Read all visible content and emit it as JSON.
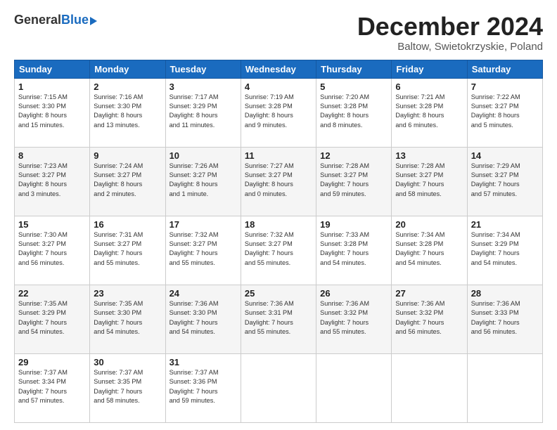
{
  "logo": {
    "general": "General",
    "blue": "Blue"
  },
  "header": {
    "month": "December 2024",
    "location": "Baltow, Swietokrzyskie, Poland"
  },
  "days_of_week": [
    "Sunday",
    "Monday",
    "Tuesday",
    "Wednesday",
    "Thursday",
    "Friday",
    "Saturday"
  ],
  "weeks": [
    [
      {
        "day": "1",
        "info": "Sunrise: 7:15 AM\nSunset: 3:30 PM\nDaylight: 8 hours\nand 15 minutes."
      },
      {
        "day": "2",
        "info": "Sunrise: 7:16 AM\nSunset: 3:30 PM\nDaylight: 8 hours\nand 13 minutes."
      },
      {
        "day": "3",
        "info": "Sunrise: 7:17 AM\nSunset: 3:29 PM\nDaylight: 8 hours\nand 11 minutes."
      },
      {
        "day": "4",
        "info": "Sunrise: 7:19 AM\nSunset: 3:28 PM\nDaylight: 8 hours\nand 9 minutes."
      },
      {
        "day": "5",
        "info": "Sunrise: 7:20 AM\nSunset: 3:28 PM\nDaylight: 8 hours\nand 8 minutes."
      },
      {
        "day": "6",
        "info": "Sunrise: 7:21 AM\nSunset: 3:28 PM\nDaylight: 8 hours\nand 6 minutes."
      },
      {
        "day": "7",
        "info": "Sunrise: 7:22 AM\nSunset: 3:27 PM\nDaylight: 8 hours\nand 5 minutes."
      }
    ],
    [
      {
        "day": "8",
        "info": "Sunrise: 7:23 AM\nSunset: 3:27 PM\nDaylight: 8 hours\nand 3 minutes."
      },
      {
        "day": "9",
        "info": "Sunrise: 7:24 AM\nSunset: 3:27 PM\nDaylight: 8 hours\nand 2 minutes."
      },
      {
        "day": "10",
        "info": "Sunrise: 7:26 AM\nSunset: 3:27 PM\nDaylight: 8 hours\nand 1 minute."
      },
      {
        "day": "11",
        "info": "Sunrise: 7:27 AM\nSunset: 3:27 PM\nDaylight: 8 hours\nand 0 minutes."
      },
      {
        "day": "12",
        "info": "Sunrise: 7:28 AM\nSunset: 3:27 PM\nDaylight: 7 hours\nand 59 minutes."
      },
      {
        "day": "13",
        "info": "Sunrise: 7:28 AM\nSunset: 3:27 PM\nDaylight: 7 hours\nand 58 minutes."
      },
      {
        "day": "14",
        "info": "Sunrise: 7:29 AM\nSunset: 3:27 PM\nDaylight: 7 hours\nand 57 minutes."
      }
    ],
    [
      {
        "day": "15",
        "info": "Sunrise: 7:30 AM\nSunset: 3:27 PM\nDaylight: 7 hours\nand 56 minutes."
      },
      {
        "day": "16",
        "info": "Sunrise: 7:31 AM\nSunset: 3:27 PM\nDaylight: 7 hours\nand 55 minutes."
      },
      {
        "day": "17",
        "info": "Sunrise: 7:32 AM\nSunset: 3:27 PM\nDaylight: 7 hours\nand 55 minutes."
      },
      {
        "day": "18",
        "info": "Sunrise: 7:32 AM\nSunset: 3:27 PM\nDaylight: 7 hours\nand 55 minutes."
      },
      {
        "day": "19",
        "info": "Sunrise: 7:33 AM\nSunset: 3:28 PM\nDaylight: 7 hours\nand 54 minutes."
      },
      {
        "day": "20",
        "info": "Sunrise: 7:34 AM\nSunset: 3:28 PM\nDaylight: 7 hours\nand 54 minutes."
      },
      {
        "day": "21",
        "info": "Sunrise: 7:34 AM\nSunset: 3:29 PM\nDaylight: 7 hours\nand 54 minutes."
      }
    ],
    [
      {
        "day": "22",
        "info": "Sunrise: 7:35 AM\nSunset: 3:29 PM\nDaylight: 7 hours\nand 54 minutes."
      },
      {
        "day": "23",
        "info": "Sunrise: 7:35 AM\nSunset: 3:30 PM\nDaylight: 7 hours\nand 54 minutes."
      },
      {
        "day": "24",
        "info": "Sunrise: 7:36 AM\nSunset: 3:30 PM\nDaylight: 7 hours\nand 54 minutes."
      },
      {
        "day": "25",
        "info": "Sunrise: 7:36 AM\nSunset: 3:31 PM\nDaylight: 7 hours\nand 55 minutes."
      },
      {
        "day": "26",
        "info": "Sunrise: 7:36 AM\nSunset: 3:32 PM\nDaylight: 7 hours\nand 55 minutes."
      },
      {
        "day": "27",
        "info": "Sunrise: 7:36 AM\nSunset: 3:32 PM\nDaylight: 7 hours\nand 56 minutes."
      },
      {
        "day": "28",
        "info": "Sunrise: 7:36 AM\nSunset: 3:33 PM\nDaylight: 7 hours\nand 56 minutes."
      }
    ],
    [
      {
        "day": "29",
        "info": "Sunrise: 7:37 AM\nSunset: 3:34 PM\nDaylight: 7 hours\nand 57 minutes."
      },
      {
        "day": "30",
        "info": "Sunrise: 7:37 AM\nSunset: 3:35 PM\nDaylight: 7 hours\nand 58 minutes."
      },
      {
        "day": "31",
        "info": "Sunrise: 7:37 AM\nSunset: 3:36 PM\nDaylight: 7 hours\nand 59 minutes."
      },
      {
        "day": "",
        "info": ""
      },
      {
        "day": "",
        "info": ""
      },
      {
        "day": "",
        "info": ""
      },
      {
        "day": "",
        "info": ""
      }
    ]
  ]
}
